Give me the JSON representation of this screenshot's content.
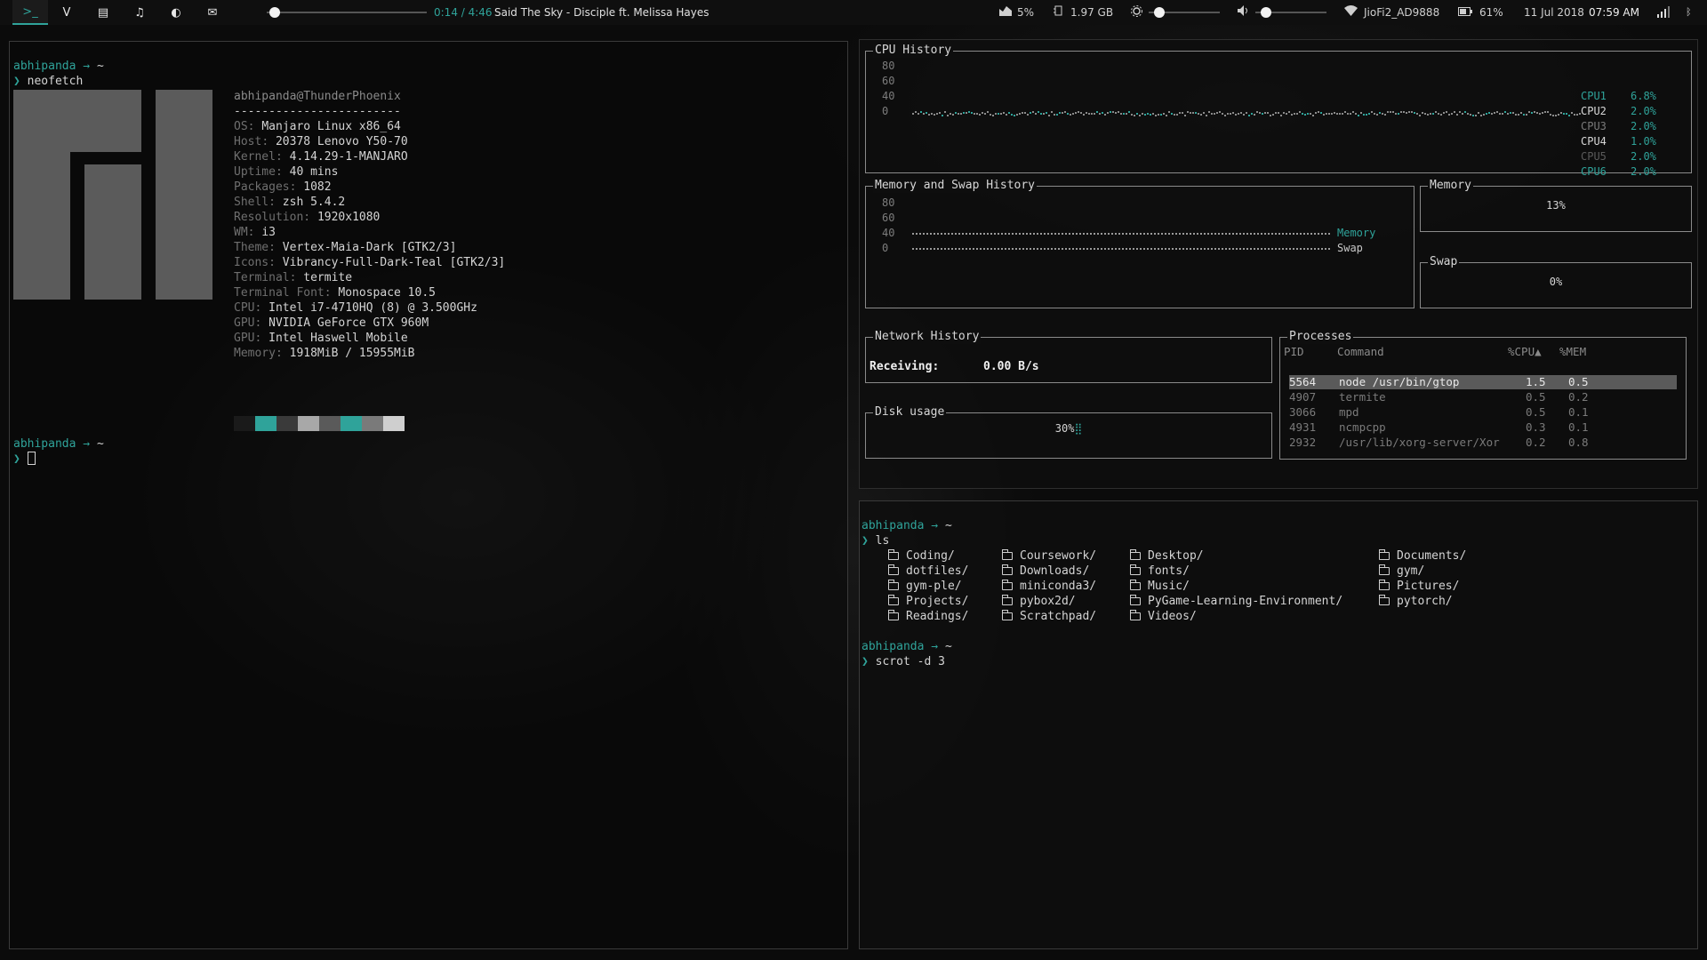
{
  "bar": {
    "workspaces": [
      {
        "name": "terminal-workspace",
        "glyph": ">_",
        "active": true
      },
      {
        "name": "vivaldi-workspace",
        "glyph": "V",
        "active": false
      },
      {
        "name": "files-workspace",
        "glyph": "▤",
        "active": false
      },
      {
        "name": "music-workspace",
        "glyph": "♫",
        "active": false
      },
      {
        "name": "media-workspace",
        "glyph": "◐",
        "active": false
      },
      {
        "name": "mail-workspace",
        "glyph": "✉",
        "active": false
      }
    ],
    "player_progress": 0.05,
    "player_time": "0:14 / 4:46",
    "track": "Said The Sky - Disciple ft. Melissa Hayes",
    "cpu_percent": "5%",
    "ram_used": "1.97 GB",
    "brightness_level": 0.15,
    "volume_level": 0.15,
    "wifi_name": "JioFi2_AD9888",
    "battery": "61%",
    "date": "11 Jul 2018",
    "time": "07:59 AM"
  },
  "left_terminal": {
    "prompt_user": "abhipanda",
    "prompt_arrow": "→",
    "prompt_dir": "~",
    "prompt_symbol": "❯",
    "command": "neofetch",
    "neofetch": {
      "title": "abhipanda@ThunderPhoenix",
      "separator": "------------------------",
      "fields": [
        {
          "key": "OS",
          "value": "Manjaro Linux x86_64"
        },
        {
          "key": "Host",
          "value": "20378 Lenovo Y50-70"
        },
        {
          "key": "Kernel",
          "value": "4.14.29-1-MANJARO"
        },
        {
          "key": "Uptime",
          "value": "40 mins"
        },
        {
          "key": "Packages",
          "value": "1082"
        },
        {
          "key": "Shell",
          "value": "zsh 5.4.2"
        },
        {
          "key": "Resolution",
          "value": "1920x1080"
        },
        {
          "key": "WM",
          "value": "i3"
        },
        {
          "key": "Theme",
          "value": "Vertex-Maia-Dark [GTK2/3]"
        },
        {
          "key": "Icons",
          "value": "Vibrancy-Full-Dark-Teal [GTK2/3]"
        },
        {
          "key": "Terminal",
          "value": "termite"
        },
        {
          "key": "Terminal Font",
          "value": "Monospace 10.5"
        },
        {
          "key": "CPU",
          "value": "Intel i7-4710HQ (8) @ 3.500GHz"
        },
        {
          "key": "GPU",
          "value": "NVIDIA GeForce GTX 960M"
        },
        {
          "key": "GPU",
          "value": "Intel Haswell Mobile"
        },
        {
          "key": "Memory",
          "value": "1918MiB / 15955MiB"
        }
      ],
      "palette": [
        "#1a1a1a",
        "#2fa39a",
        "#3a3a3a",
        "#a8a8a8",
        "#5a5a5a",
        "#2fa39a",
        "#7a7a7a",
        "#cfcfcf"
      ]
    }
  },
  "gtop": {
    "cpu_history": {
      "title": "CPU History",
      "axis": [
        "80",
        "60",
        "40",
        "0"
      ],
      "cpus": [
        {
          "name": "CPU1",
          "value": "6.8%",
          "color": "#2fa39a"
        },
        {
          "name": "CPU2",
          "value": "2.0%",
          "color": "#d8d8d8"
        },
        {
          "name": "CPU3",
          "value": "2.0%",
          "color": "#7a7a7a"
        },
        {
          "name": "CPU4",
          "value": "1.0%",
          "color": "#d8d8d8"
        },
        {
          "name": "CPU5",
          "value": "2.0%",
          "color": "#5a5a5a"
        },
        {
          "name": "CPU6",
          "value": "2.0%",
          "color": "#2fa39a"
        }
      ]
    },
    "mem_history": {
      "title": "Memory and Swap History",
      "axis": [
        "80",
        "60",
        "40",
        "0"
      ],
      "legend": [
        {
          "name": "Memory",
          "color": "#2fa39a"
        },
        {
          "name": "Swap",
          "color": "#c8c8c8"
        }
      ]
    },
    "memory": {
      "title": "Memory",
      "value": "13%"
    },
    "swap": {
      "title": "Swap",
      "value": "0%"
    },
    "network": {
      "title": "Network History",
      "label": "Receiving:",
      "value": "0.00 B/s"
    },
    "disk": {
      "title": "Disk usage",
      "value": "30%"
    },
    "processes": {
      "title": "Processes",
      "headers": {
        "pid": "PID",
        "command": "Command",
        "cpu": "%CPU▲",
        "mem": "%MEM"
      },
      "rows": [
        {
          "pid": "5564",
          "command": "node /usr/bin/gtop",
          "cpu": "1.5",
          "mem": "0.5"
        },
        {
          "pid": "4907",
          "command": "termite",
          "cpu": "0.5",
          "mem": "0.2"
        },
        {
          "pid": "3066",
          "command": "mpd",
          "cpu": "0.5",
          "mem": "0.1"
        },
        {
          "pid": "4931",
          "command": "ncmpcpp",
          "cpu": "0.3",
          "mem": "0.1"
        },
        {
          "pid": "2932",
          "command": "/usr/lib/xorg-server/Xor",
          "cpu": "0.2",
          "mem": "0.8"
        }
      ]
    }
  },
  "right_terminal": {
    "prompt_user": "abhipanda",
    "prompt_arrow": "→",
    "prompt_dir": "~",
    "prompt_symbol": "❯",
    "command1": "ls",
    "ls_columns": [
      [
        "Coding/",
        "dotfiles/",
        "gym-ple/",
        "Projects/",
        "Readings/"
      ],
      [
        "Coursework/",
        "Downloads/",
        "miniconda3/",
        "pybox2d/",
        "Scratchpad/"
      ],
      [
        "Desktop/",
        "fonts/",
        "Music/",
        "PyGame-Learning-Environment/",
        "Videos/"
      ],
      [
        "Documents/",
        "gym/",
        "Pictures/",
        "pytorch/"
      ]
    ],
    "command2": "scrot -d 3"
  }
}
